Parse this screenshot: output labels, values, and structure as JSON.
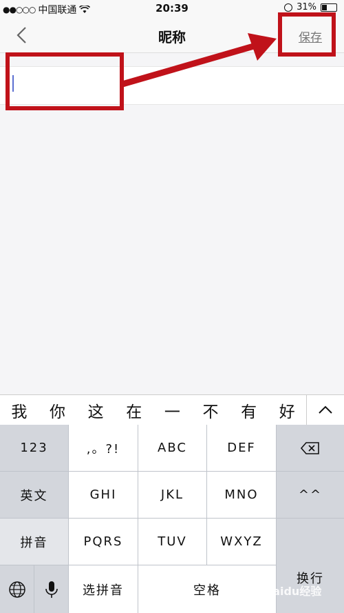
{
  "status_bar": {
    "signal_dots": "●●○○○",
    "carrier": "中国联通",
    "time": "20:39",
    "battery": "31%"
  },
  "nav": {
    "title": "昵称",
    "save_label": "保存",
    "back_icon": "chevron-left-icon"
  },
  "nickname_field": {
    "value": ""
  },
  "annotation": {
    "color": "#c0121a"
  },
  "keyboard": {
    "candidates": [
      "我",
      "你",
      "这",
      "在",
      "一",
      "不",
      "有",
      "好"
    ],
    "rows": {
      "row1": {
        "left": "123",
        "k1": ",。?!",
        "k2": "ABC",
        "k3": "DEF"
      },
      "row2": {
        "left": "英文",
        "k1": "GHI",
        "k2": "JKL",
        "k3": "MNO",
        "right": "^^"
      },
      "row3": {
        "left": "拼音",
        "k1": "PQRS",
        "k2": "TUV",
        "k3": "WXYZ"
      },
      "row4": {
        "select_pinyin": "选拼音",
        "space": "空格"
      },
      "return_label": "换行"
    }
  },
  "watermark": "Baidu经验"
}
